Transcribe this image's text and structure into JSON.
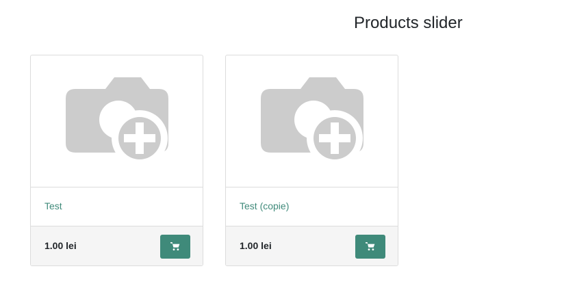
{
  "page": {
    "title": "Products slider"
  },
  "products": [
    {
      "name": "Test",
      "price": "1.00 lei",
      "image_icon": "camera-plus-placeholder-icon",
      "cart_icon": "shopping-cart-icon"
    },
    {
      "name": "Test (copie)",
      "price": "1.00 lei",
      "image_icon": "camera-plus-placeholder-icon",
      "cart_icon": "shopping-cart-icon"
    }
  ],
  "colors": {
    "accent": "#3f8a7a",
    "placeholder_gray": "#cccccc",
    "border": "#dcdcdc",
    "footer_bg": "#f5f5f5",
    "title_text": "#212529"
  }
}
